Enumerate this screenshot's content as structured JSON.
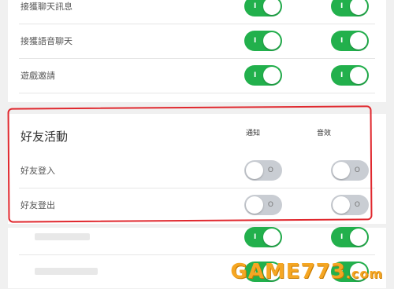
{
  "colors": {
    "toggle_on": "#22b04c",
    "toggle_off": "#c9cdd3",
    "highlight": "#e0282e",
    "watermark": "#f5a623"
  },
  "top_section": {
    "rows": [
      {
        "label": "接獲聊天訊息",
        "notify": "on",
        "sound": "on"
      },
      {
        "label": "接獲語音聊天",
        "notify": "on",
        "sound": "on"
      },
      {
        "label": "遊戲邀請",
        "notify": "on",
        "sound": "on"
      }
    ]
  },
  "friend_activity": {
    "title": "好友活動",
    "col_notify": "通知",
    "col_sound": "音效",
    "rows": [
      {
        "label": "好友登入",
        "notify": "off",
        "sound": "off"
      },
      {
        "label": "好友登出",
        "notify": "off",
        "sound": "off"
      }
    ]
  },
  "bottom_section": {
    "rows": [
      {
        "label": "",
        "notify": "on",
        "sound": "on"
      },
      {
        "label": "",
        "notify": "on",
        "sound": "on"
      }
    ]
  },
  "toggle": {
    "on_mark": "I",
    "off_mark": "O"
  },
  "watermark": {
    "brand": "GAME773",
    "tld": ".com"
  }
}
